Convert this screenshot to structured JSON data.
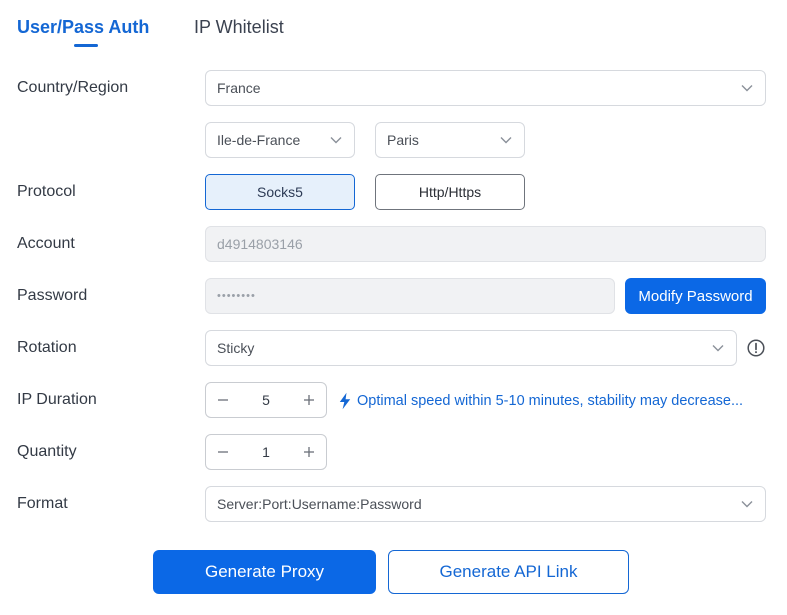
{
  "tabs": [
    {
      "label": "User/Pass Auth",
      "active": true
    },
    {
      "label": "IP Whitelist",
      "active": false
    }
  ],
  "country": {
    "label": "Country/Region",
    "value": "France",
    "region": "Ile-de-France",
    "city": "Paris"
  },
  "protocol": {
    "label": "Protocol",
    "options": [
      "Socks5",
      "Http/Https"
    ],
    "selected": "Socks5"
  },
  "account": {
    "label": "Account",
    "value": "d4914803146"
  },
  "password": {
    "label": "Password",
    "value": "••••••••",
    "modify_label": "Modify Password"
  },
  "rotation": {
    "label": "Rotation",
    "value": "Sticky",
    "info_icon": "info-circle-icon"
  },
  "ip_duration": {
    "label": "IP Duration",
    "value": "5",
    "hint": "Optimal speed within 5-10 minutes, stability may decrease...",
    "hint_icon": "lightning-bolt-icon"
  },
  "quantity": {
    "label": "Quantity",
    "value": "1"
  },
  "format": {
    "label": "Format",
    "value": "Server:Port:Username:Password"
  },
  "actions": {
    "generate_proxy": "Generate Proxy",
    "generate_api_link": "Generate API Link"
  },
  "colors": {
    "accent": "#1467d4",
    "primary_button": "#0b68e6",
    "selected_bg": "#e6f0fb",
    "disabled_bg": "#f1f2f4"
  }
}
